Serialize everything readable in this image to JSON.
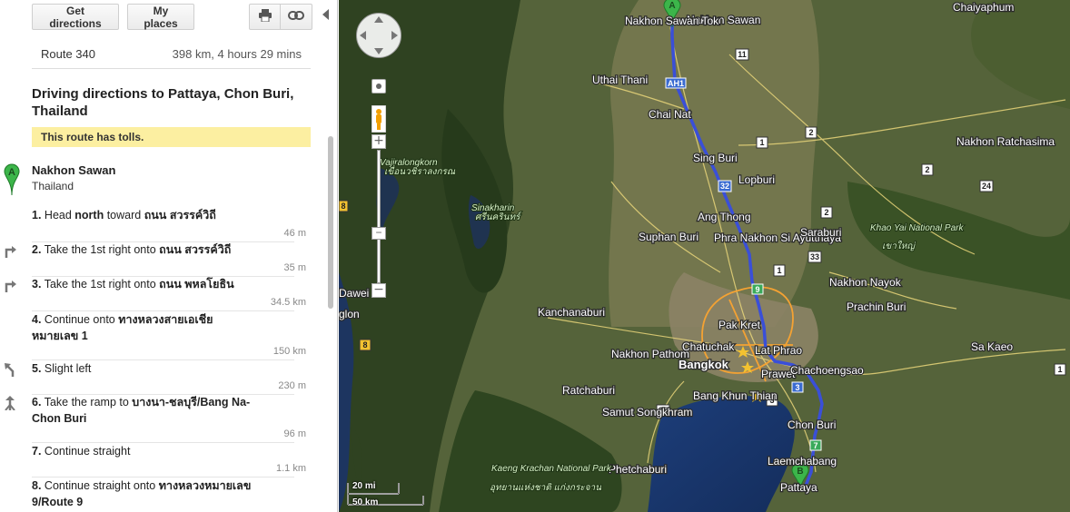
{
  "toolbar": {
    "directions_label": "Get directions",
    "places_label": "My places"
  },
  "route": {
    "name": "Route 340",
    "distance": "398 km, 4 hours 29 mins"
  },
  "directions": {
    "title": "Driving directions to Pattaya, Chon Buri, Thailand",
    "tolls_notice": "This route has tolls.",
    "start_marker": "A",
    "start_city": "Nakhon Sawan",
    "start_country": "Thailand"
  },
  "steps": [
    {
      "num": "1.",
      "pre": "Head ",
      "bold1": "north",
      "mid": " toward ",
      "bold2": "ถนน สวรรค์วิถี",
      "dist": "46 m"
    },
    {
      "num": "2.",
      "pre": "Take the 1st right onto ",
      "bold1": "",
      "mid": "",
      "bold2": "ถนน สวรรค์วิถี",
      "dist": "35 m"
    },
    {
      "num": "3.",
      "pre": "Take the 1st right onto ",
      "bold1": "",
      "mid": "",
      "bold2": "ถนน พหลโยธิน",
      "dist": "34.5 km"
    },
    {
      "num": "4.",
      "pre": "Continue onto ",
      "bold1": "",
      "mid": "",
      "bold2": "ทางหลวงสายเอเชีย หมายเลข 1",
      "dist": "150 km"
    },
    {
      "num": "5.",
      "pre": "Slight left",
      "bold1": "",
      "mid": "",
      "bold2": "",
      "dist": "230 m"
    },
    {
      "num": "6.",
      "pre": "Take the ramp to ",
      "bold1": "",
      "mid": "",
      "bold2": "บางนา-ชลบุรี/Bang Na-Chon Buri",
      "dist": "96 m"
    },
    {
      "num": "7.",
      "pre": "Continue straight",
      "bold1": "",
      "mid": "",
      "bold2": "",
      "dist": "1.1 km"
    },
    {
      "num": "8.",
      "pre": "Continue straight onto ",
      "bold1": "",
      "mid": "",
      "bold2": "ทางหลวงหมายเลข 9/Route 9",
      "dist": ""
    }
  ],
  "map": {
    "marker_a": "A",
    "marker_b": "B",
    "route_color": "#3a4fd8",
    "scale_mi": "20 mi",
    "scale_km": "50 km",
    "labels": {
      "nakhon_sawan": "Nakhon Sawan",
      "nakhon_sawan_tok": "Nakhon Sawan Tok",
      "chaiyaphum": "Chaiyaphum",
      "uthai_thani": "Uthai Thani",
      "chai_nat": "Chai Nat",
      "sing_buri": "Sing Buri",
      "lopburi": "Lopburi",
      "ang_thong": "Ang Thong",
      "suphan_buri": "Suphan Buri",
      "phra_nakhon_si_ayutthaya": "Phra Nakhon Si Ayutthaya",
      "saraburi": "Saraburi",
      "nakhon_ratchasima": "Nakhon Ratchasima",
      "khao_yai": "Khao Yai National Park",
      "khao_yai_thai": "เขาใหญ่",
      "nakhon_nayok": "Nakhon Nayok",
      "prachin_buri": "Prachin Buri",
      "sa_kaeo": "Sa Kaeo",
      "kanchanaburi": "Kanchanaburi",
      "pak_kret": "Pak Kret",
      "chatuchak": "Chatuchak",
      "lat_phrao": "Lat Phrao",
      "nakhon_pathom": "Nakhon Pathom",
      "bangkok": "Bangkok",
      "prawet": "Prawet",
      "chachoengsao": "Chachoengsao",
      "ratchaburi": "Ratchaburi",
      "bang_khun_thian": "Bang Khun Thian",
      "samut_songkhram": "Samut Songkhram",
      "chon_buri": "Chon Buri",
      "laem_chabang": "Laemchabang",
      "pattaya": "Pattaya",
      "phetchaburi": "Phetchaburi",
      "kaeng_krachan": "Kaeng Krachan National Park",
      "kaeng_krachan_thai": "อุทยานแห่งชาติ แก่งกระจาน",
      "vajiralongkorn": "Vajiralongkorn",
      "vajiralongkorn_thai": "เขื่อนวชิราลงกรณ",
      "srinagarind": "Sinakharin",
      "srinagarind_thai": "ศรีนครินทร์",
      "dawei": "Dawei",
      "glon": "glon"
    },
    "shields": {
      "ah1": "AH1",
      "r11": "11",
      "r1a": "1",
      "r32": "32",
      "r2a": "2",
      "r2b": "2",
      "r24": "24",
      "r2c": "2",
      "r1b": "1",
      "r33": "33",
      "r9": "9",
      "r35": "35",
      "r3": "3",
      "r7": "7",
      "r8a": "8",
      "r8b": "8",
      "r3b": "3",
      "r1c": "1"
    }
  }
}
